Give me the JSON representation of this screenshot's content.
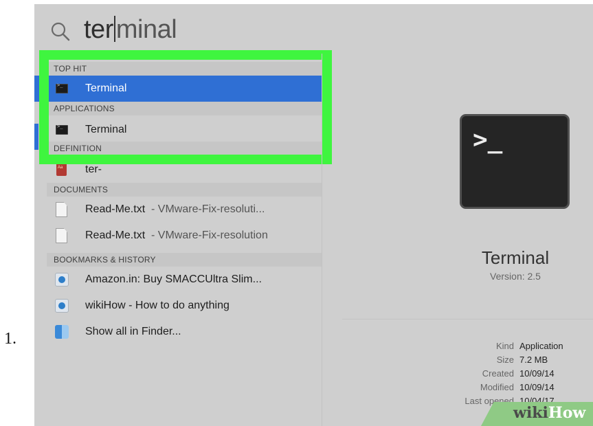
{
  "step": {
    "number": "1."
  },
  "search": {
    "typed": "ter",
    "completion": "minal"
  },
  "sections": {
    "top_hit": "TOP HIT",
    "applications": "APPLICATIONS",
    "definition": "DEFINITION",
    "documents": "DOCUMENTS",
    "bookmarks": "BOOKMARKS & HISTORY"
  },
  "results": {
    "top_hit": {
      "label": "Terminal",
      "icon": "terminal-icon"
    },
    "application": {
      "label": "Terminal",
      "icon": "terminal-icon"
    },
    "definition": {
      "label": "ter-",
      "icon": "dictionary-icon"
    },
    "documents": [
      {
        "name": "Read-Me.txt",
        "sub": "- VMware-Fix-resoluti...",
        "icon": "text-document-icon"
      },
      {
        "name": "Read-Me.txt",
        "sub": "- VMware-Fix-resolution",
        "icon": "text-document-icon"
      }
    ],
    "bookmarks": [
      {
        "label": "Amazon.in: Buy SMACCUltra Slim...",
        "icon": "webpage-icon"
      },
      {
        "label": "wikiHow - How to do anything",
        "icon": "webpage-icon"
      }
    ],
    "show_all": {
      "label": "Show all in Finder...",
      "icon": "finder-icon"
    }
  },
  "preview": {
    "icon_glyph": ">_",
    "name": "Terminal",
    "version": "Version: 2.5",
    "meta": [
      {
        "key": "Kind",
        "value": "Application"
      },
      {
        "key": "Size",
        "value": "7.2 MB"
      },
      {
        "key": "Created",
        "value": "10/09/14"
      },
      {
        "key": "Modified",
        "value": "10/09/14"
      },
      {
        "key": "Last opened",
        "value": "10/04/17"
      }
    ]
  },
  "watermark": {
    "wiki": "wiki",
    "how": "How"
  },
  "colors": {
    "selection": "#2f6fd4",
    "highlight_frame": "#3ff53f",
    "panel_bg": "#cfcfcf"
  }
}
